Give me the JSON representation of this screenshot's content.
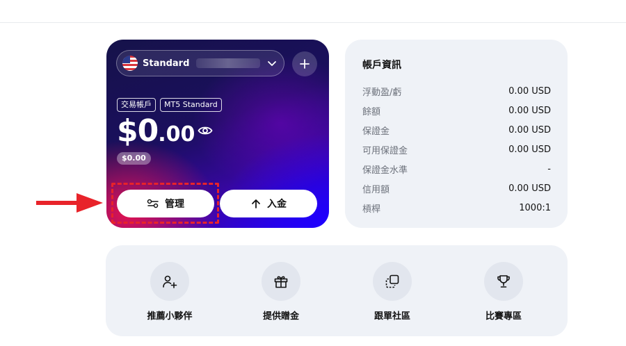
{
  "account": {
    "name": "Standard",
    "tags": [
      "交易帳戶",
      "MT5 Standard"
    ],
    "balance_main": "$0",
    "balance_decimal": ".00",
    "sub_balance": "$0.00",
    "manage_label": "管理",
    "deposit_label": "入金"
  },
  "info": {
    "title": "帳戶資訊",
    "rows": [
      {
        "label": "浮動盈/虧",
        "value": "0.00 USD"
      },
      {
        "label": "餘額",
        "value": "0.00 USD"
      },
      {
        "label": "保證金",
        "value": "0.00 USD"
      },
      {
        "label": "可用保證金",
        "value": "0.00 USD"
      },
      {
        "label": "保證金水準",
        "value": "-"
      },
      {
        "label": "信用額",
        "value": "0.00 USD"
      },
      {
        "label": "槓桿",
        "value": "1000:1"
      }
    ]
  },
  "shortcuts": [
    {
      "label": "推薦小夥伴",
      "icon": "user-plus-icon"
    },
    {
      "label": "提供贈金",
      "icon": "gift-icon"
    },
    {
      "label": "跟單社區",
      "icon": "copy-icon"
    },
    {
      "label": "比賽專區",
      "icon": "trophy-icon"
    }
  ],
  "colors": {
    "highlight": "#e8232a",
    "panel_bg": "#eff2f7"
  }
}
